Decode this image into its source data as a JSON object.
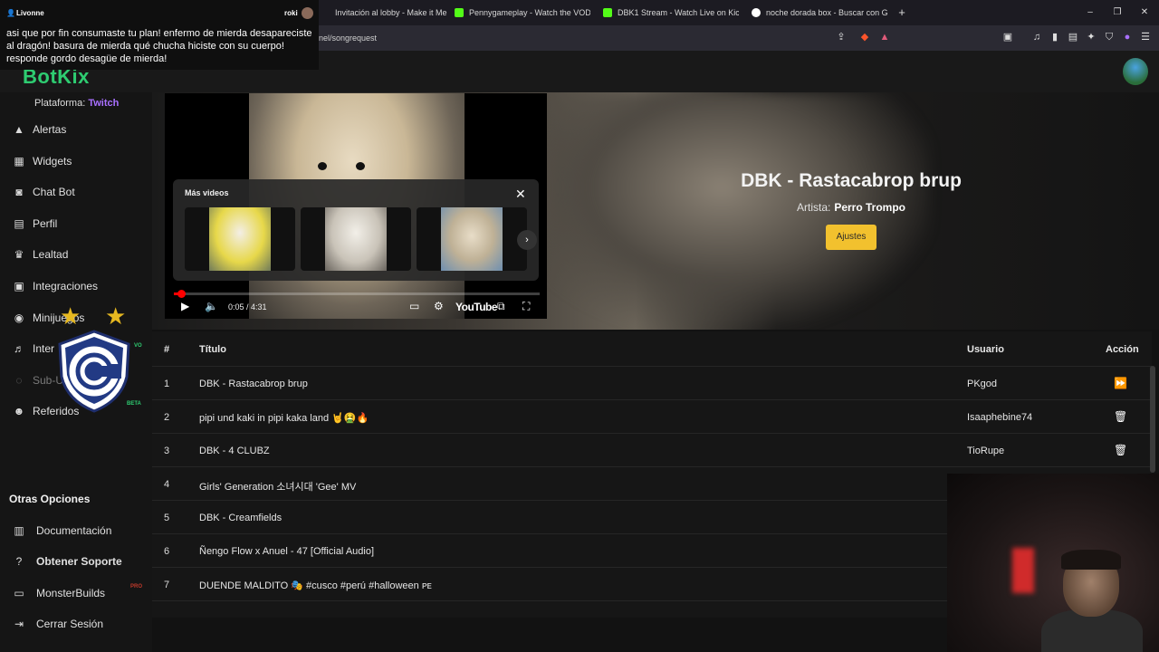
{
  "browser": {
    "tabs": [
      {
        "label": "Invitación al lobby - Make it Meme",
        "fav_color": "#444444"
      },
      {
        "label": "Pennygameplay - Watch the VOD on",
        "fav_color": "#53fc18"
      },
      {
        "label": "DBK1 Stream - Watch Live on Kick",
        "fav_color": "#53fc18"
      },
      {
        "label": "noche dorada box - Buscar con Goog",
        "fav_color": "#ffffff"
      }
    ],
    "new_tab": "+",
    "url": "nel/songrequest"
  },
  "chat": {
    "username": "Livonne",
    "other_user": "roki",
    "message": "asi que por fin consumaste tu plan! enfermo de mierda desapareciste al dragón! basura de mierda qué chucha hiciste con su cuerpo! responde gordo desagüe de mierda!"
  },
  "app": {
    "logo": "BotKix",
    "platform_label": "Plataforma:",
    "platform_value": "Twitch"
  },
  "sidebar": {
    "items": [
      {
        "label": "Alertas",
        "icon": "warning-icon"
      },
      {
        "label": "Widgets",
        "icon": "widgets-icon"
      },
      {
        "label": "Chat Bot",
        "icon": "robot-icon"
      },
      {
        "label": "Perfil",
        "icon": "id-card-icon"
      },
      {
        "label": "Lealtad",
        "icon": "trophy-icon"
      },
      {
        "label": "Integraciones",
        "icon": "plug-icon"
      },
      {
        "label": "Minijuegos",
        "icon": "gamepad-icon"
      },
      {
        "label": "Inter",
        "icon": "music-icon",
        "badge": "VO"
      },
      {
        "label": "Sub-U",
        "icon": "sub-icon"
      },
      {
        "label": "Referidos",
        "icon": "users-icon",
        "badge": "BETA"
      }
    ],
    "other_title": "Otras Opciones",
    "other_items": [
      {
        "label": "Documentación",
        "icon": "book-icon"
      },
      {
        "label": "Obtener Soporte",
        "icon": "help-icon"
      },
      {
        "label": "MonsterBuilds",
        "icon": "laptop-icon",
        "badge": "PRO"
      },
      {
        "label": "Cerrar Sesión",
        "icon": "logout-icon"
      }
    ]
  },
  "now_playing": {
    "title": "DBK - Rastacabrop brup",
    "artist_label": "Artista:",
    "artist": "Perro Trompo",
    "settings_button": "Ajustes"
  },
  "player": {
    "more_videos": "Más videos",
    "time": "0:05 / 4:31",
    "progress": 0.02,
    "brand": "YouTube"
  },
  "queue": {
    "headers": {
      "num": "#",
      "title": "Título",
      "user": "Usuario",
      "action": "Acción"
    },
    "rows": [
      {
        "num": "1",
        "title": "DBK - Rastacabrop brup",
        "user": "PKgod",
        "action": "skip-icon"
      },
      {
        "num": "2",
        "title": "pipi und kaki in pipi kaka land 🤘🤮🔥",
        "user": "Isaaphebine74",
        "action": "trash-icon"
      },
      {
        "num": "3",
        "title": "DBK - 4 CLUBZ",
        "user": "TioRupe",
        "action": "trash-icon"
      },
      {
        "num": "4",
        "title": "Girls' Generation 소녀시대 'Gee' MV",
        "user": "",
        "action": ""
      },
      {
        "num": "5",
        "title": "DBK - Creamfields",
        "user": "",
        "action": ""
      },
      {
        "num": "6",
        "title": "Ñengo Flow x Anuel - 47 [Official Audio]",
        "user": "",
        "action": ""
      },
      {
        "num": "7",
        "title": "DUENDE MALDITO 🎭 #cusco #perú #halloween ᴘᴇ",
        "user": "",
        "action": ""
      }
    ]
  }
}
